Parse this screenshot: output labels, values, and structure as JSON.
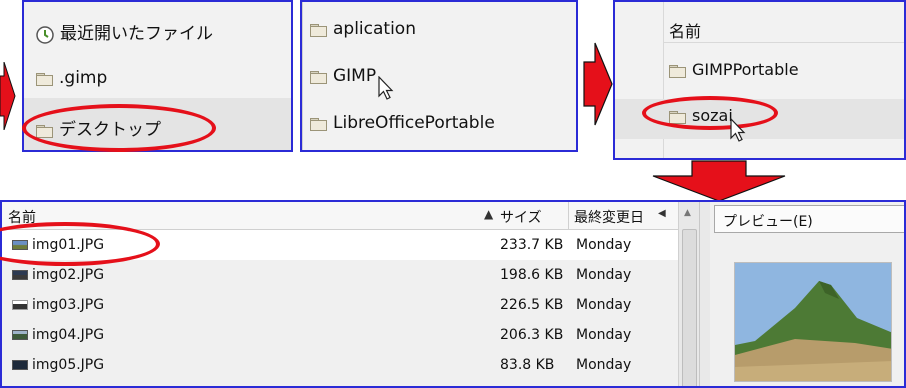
{
  "panel1": {
    "recent": "最近開いたファイル",
    "gimp": ".gimp",
    "desktop": "デスクトップ"
  },
  "panel2": {
    "items": [
      "aplication",
      "GIMP",
      "LibreOfficePortable"
    ]
  },
  "panel3": {
    "header": "名前",
    "items": [
      "GIMPPortable",
      "sozai"
    ]
  },
  "dialog": {
    "columns": {
      "name": "名前",
      "size": "サイズ",
      "modified": "最終変更日"
    },
    "sort_indicator": "▲",
    "files": [
      {
        "name": "img01.JPG",
        "size": "233.7 KB",
        "date": "Monday"
      },
      {
        "name": "img02.JPG",
        "size": "198.6 KB",
        "date": "Monday"
      },
      {
        "name": "img03.JPG",
        "size": "226.5 KB",
        "date": "Monday"
      },
      {
        "name": "img04.JPG",
        "size": "206.3 KB",
        "date": "Monday"
      },
      {
        "name": "img05.JPG",
        "size": "83.8 KB",
        "date": "Monday"
      }
    ],
    "preview_label": "プレビュー(E)",
    "preview_underline_char": "E"
  },
  "colors": {
    "highlight": "#e5101a",
    "frame": "#2b2bd6"
  }
}
